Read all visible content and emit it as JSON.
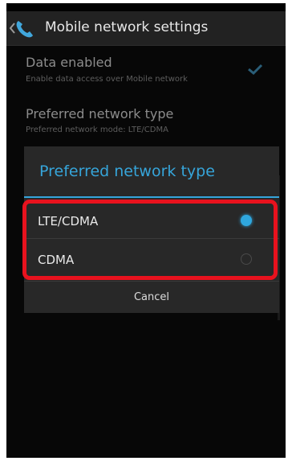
{
  "header": {
    "title": "Mobile network settings"
  },
  "settings": [
    {
      "title": "Data enabled",
      "subtitle": "Enable data access over Mobile network",
      "checked": true
    },
    {
      "title": "Preferred network type",
      "subtitle": "Preferred network mode: LTE/CDMA"
    }
  ],
  "dialog": {
    "title": "Preferred network type",
    "options": [
      {
        "label": "LTE/CDMA",
        "selected": true
      },
      {
        "label": "CDMA",
        "selected": false
      }
    ],
    "cancel_label": "Cancel"
  },
  "colors": {
    "accent": "#36a5da",
    "highlight": "#e8121e",
    "background": "#000000",
    "dialog": "#282828"
  },
  "icons": {
    "back": "back-arrow-icon",
    "app": "phone-icon",
    "check": "checkmark-icon"
  }
}
